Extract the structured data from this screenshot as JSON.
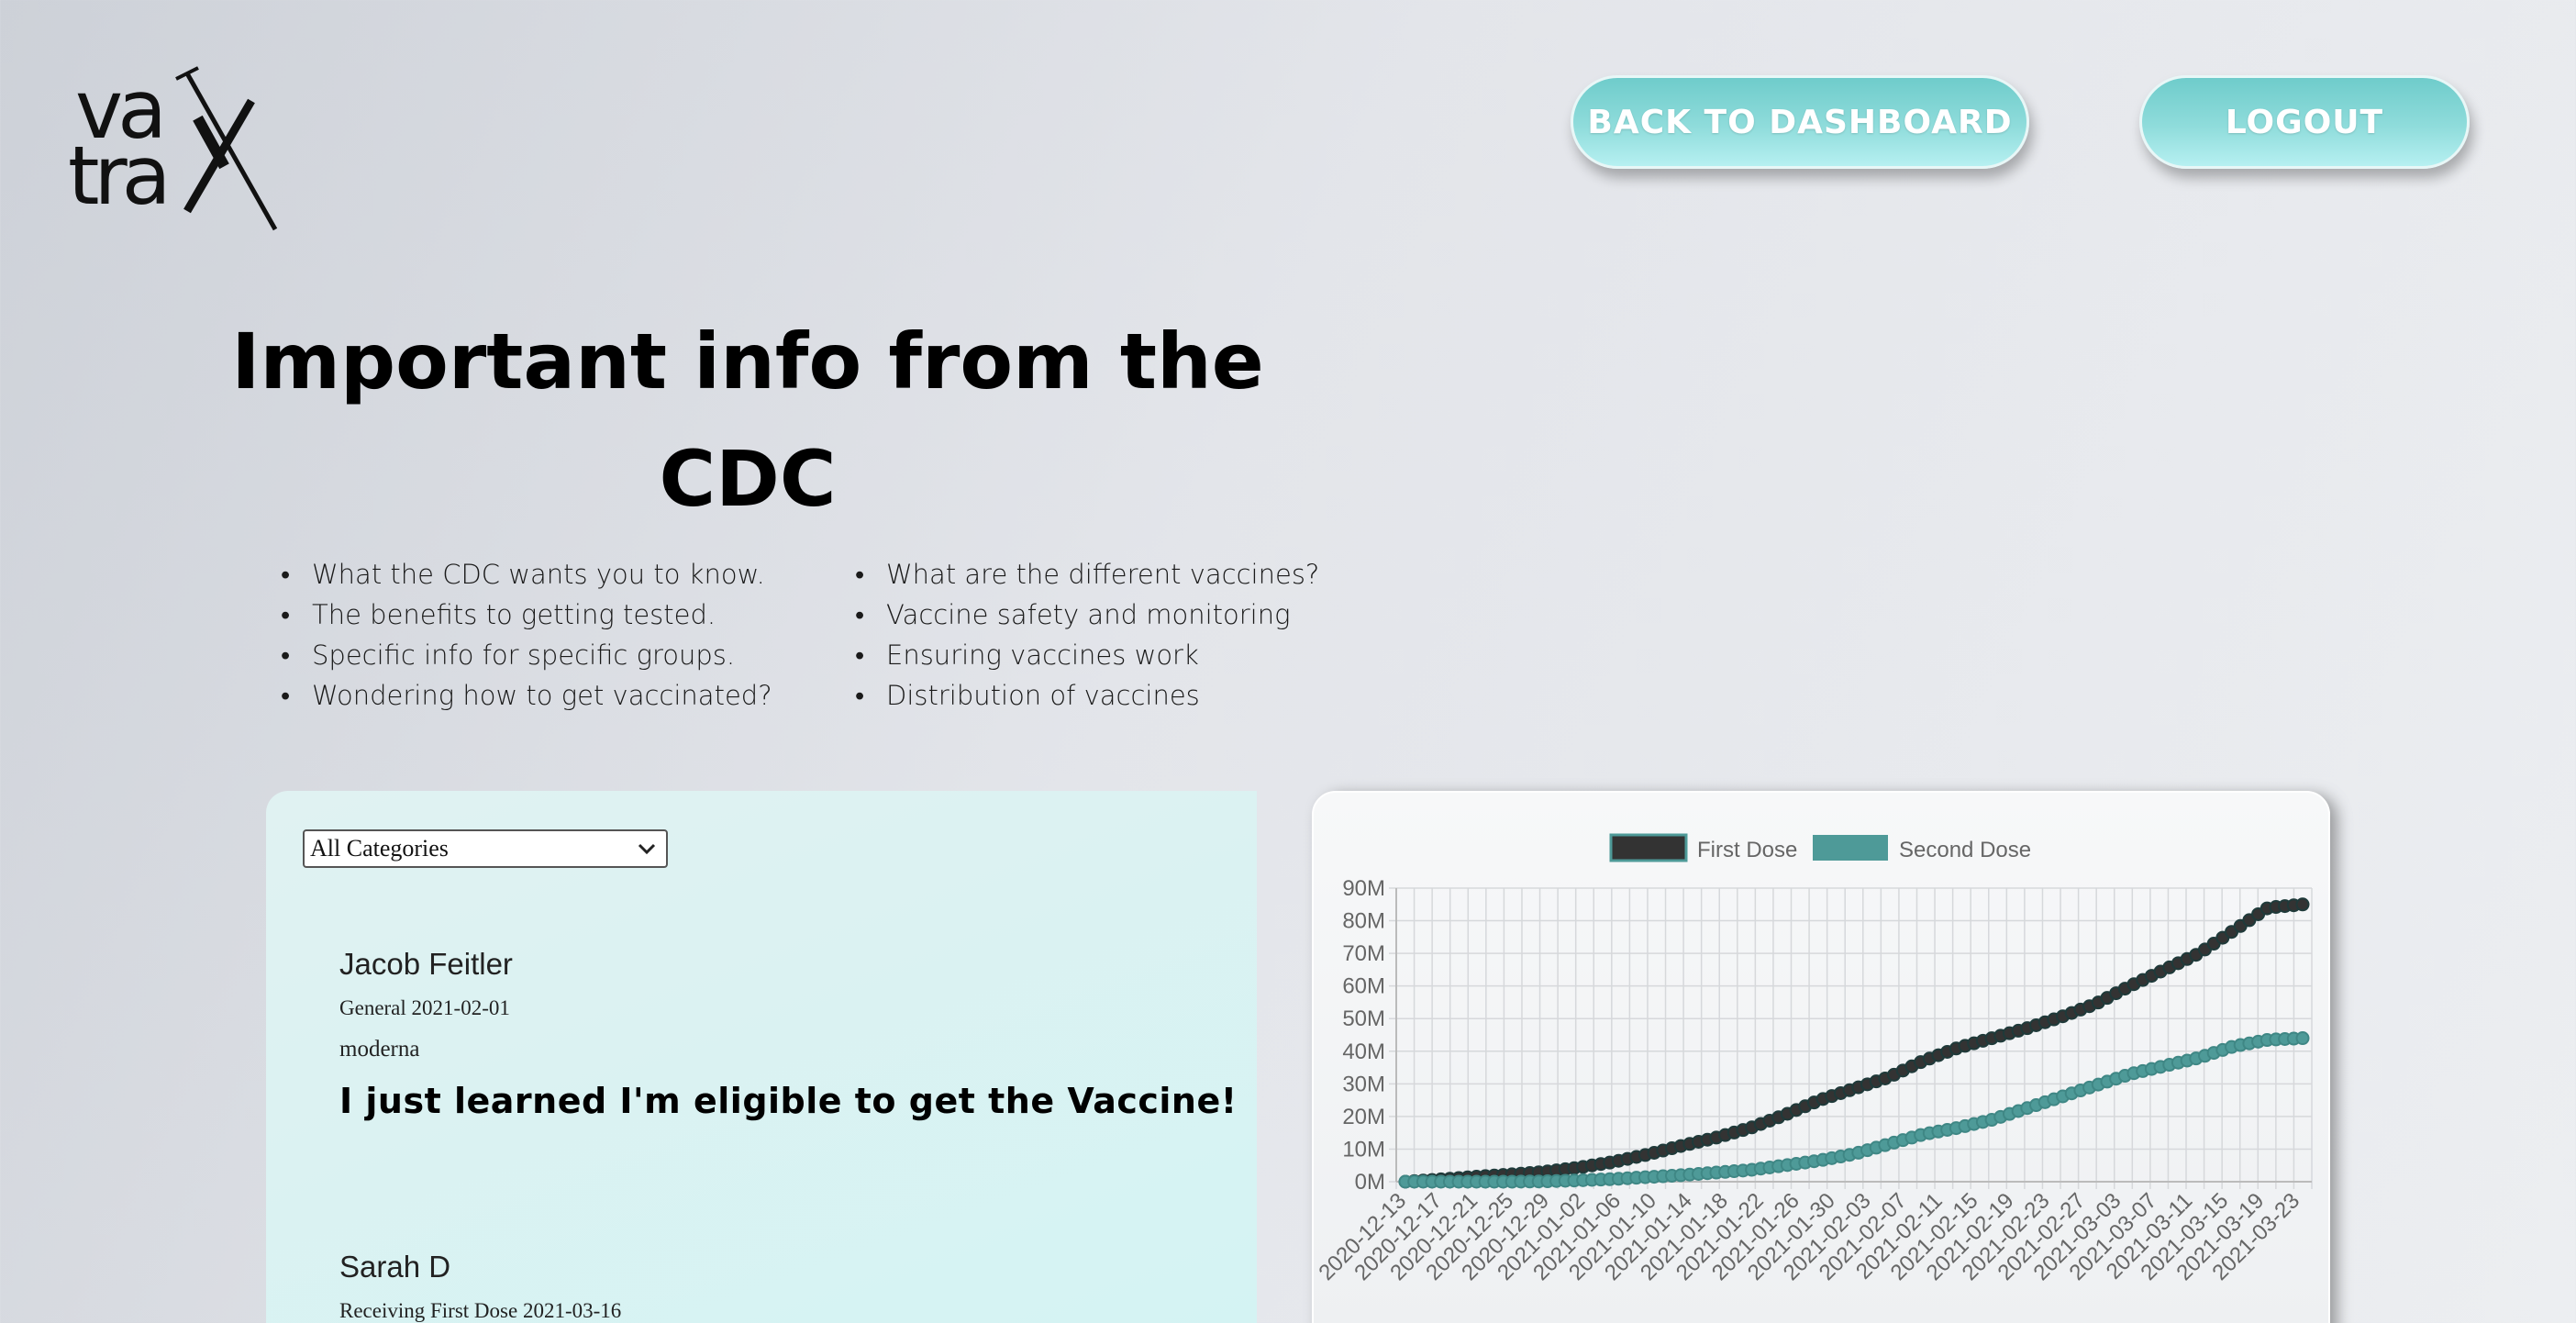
{
  "logo": {
    "line1": "va",
    "line2": "tra",
    "alt": "vaxtrax"
  },
  "nav": {
    "back_label": "BACK TO DASHBOARD",
    "logout_label": "LOGOUT"
  },
  "title": {
    "line1": "Important info from the",
    "line2": "CDC"
  },
  "info_left": [
    "What the CDC wants you to know.",
    "The benefits to getting tested.",
    "Specific info for specific groups.",
    "Wondering how to get vaccinated?"
  ],
  "info_right": [
    "What are the different vaccines?",
    "Vaccine safety and monitoring",
    "Ensuring vaccines work",
    "Distribution of vaccines"
  ],
  "filter": {
    "selected": "All Categories"
  },
  "posts": [
    {
      "author": "Jacob Feitler",
      "meta": "General 2021-02-01",
      "vaccine": "moderna",
      "headline": "I just learned I'm eligible to get the Vaccine!"
    },
    {
      "author": "Sarah D",
      "meta": "Receiving First Dose 2021-03-16"
    }
  ],
  "colors": {
    "first_dose": "#333333",
    "second_dose": "#4e9a98",
    "accent": "#8fdcdb"
  },
  "chart_data": {
    "type": "line",
    "legend": [
      "First Dose",
      "Second Dose"
    ],
    "legend_position": "top",
    "grid": true,
    "ylim": [
      0,
      90
    ],
    "y_ticks": [
      "0M",
      "10M",
      "20M",
      "30M",
      "40M",
      "50M",
      "60M",
      "70M",
      "80M",
      "90M"
    ],
    "x_ticks": [
      "2020-12-13",
      "2020-12-17",
      "2020-12-21",
      "2020-12-25",
      "2020-12-29",
      "2021-01-02",
      "2021-01-06",
      "2021-01-10",
      "2021-01-14",
      "2021-01-18",
      "2021-01-22",
      "2021-01-26",
      "2021-01-30",
      "2021-02-03",
      "2021-02-07",
      "2021-02-11",
      "2021-02-15",
      "2021-02-19",
      "2021-02-23",
      "2021-02-27",
      "2021-03-03",
      "2021-03-07",
      "2021-03-11",
      "2021-03-15",
      "2021-03-19",
      "2021-03-23"
    ],
    "series": [
      {
        "name": "First Dose",
        "values": [
          0,
          0.7,
          1.5,
          2.2,
          3,
          4.3,
          6,
          8.3,
          11,
          13.5,
          16.5,
          20.5,
          25,
          28.5,
          32,
          37,
          41,
          44,
          47,
          50.5,
          54.5,
          60,
          65,
          70,
          77,
          84,
          85
        ]
      },
      {
        "name": "Second Dose",
        "values": [
          0,
          0,
          0,
          0,
          0.1,
          0.4,
          0.8,
          1.4,
          2,
          2.8,
          3.6,
          5,
          6.5,
          8.5,
          11.5,
          14.5,
          16.5,
          19,
          22.5,
          26,
          29.5,
          33,
          35.5,
          38,
          41.5,
          43.5,
          44
        ]
      }
    ]
  }
}
